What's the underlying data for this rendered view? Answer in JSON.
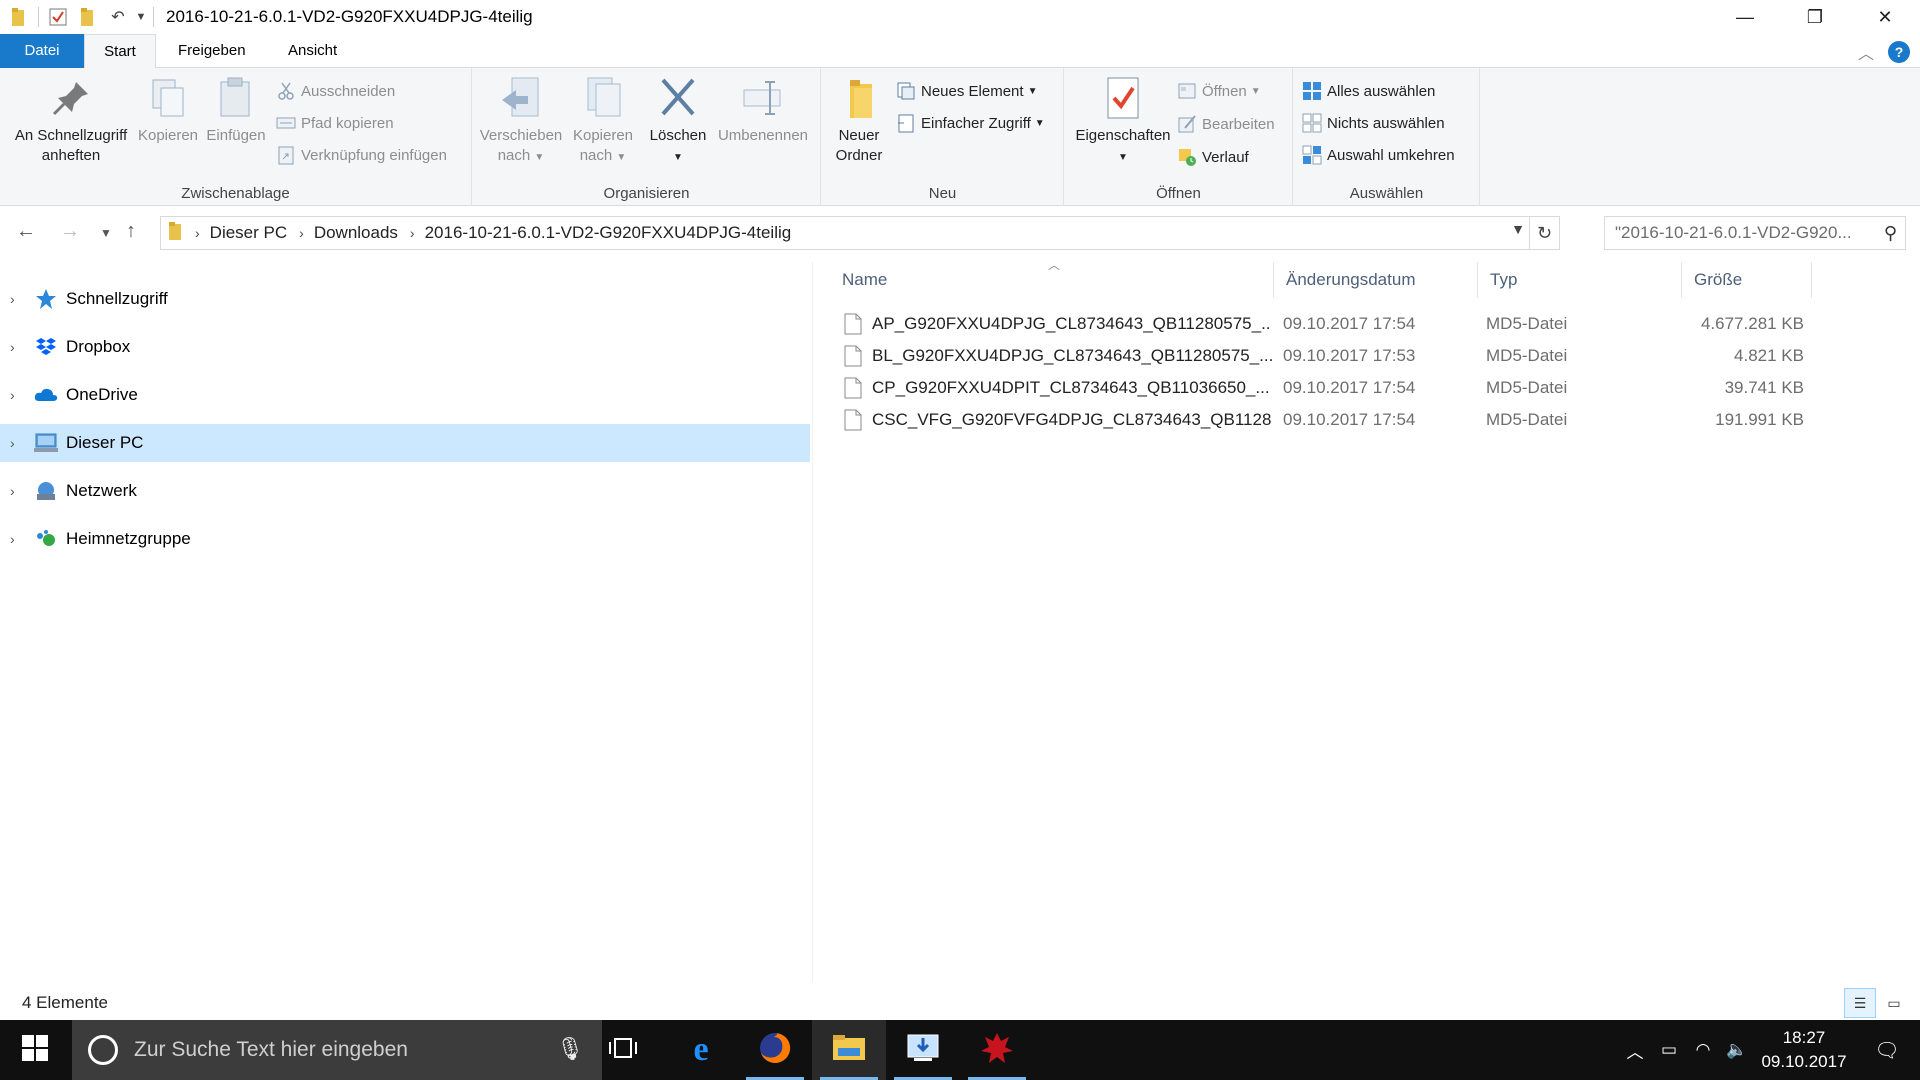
{
  "window": {
    "title": "2016-10-21-6.0.1-VD2-G920FXXU4DPJG-4teilig",
    "controls": {
      "minimize": "—",
      "restore": "❐",
      "close": "✕"
    }
  },
  "ribbon_tabs": {
    "file": "Datei",
    "start": "Start",
    "share": "Freigeben",
    "view": "Ansicht",
    "help": "?"
  },
  "ribbon": {
    "clipboard": {
      "label": "Zwischenablage",
      "pin_line1": "An Schnellzugriff",
      "pin_line2": "anheften",
      "copy": "Kopieren",
      "paste": "Einfügen",
      "cut": "Ausschneiden",
      "copy_path": "Pfad kopieren",
      "paste_shortcut": "Verknüpfung einfügen"
    },
    "organize": {
      "label": "Organisieren",
      "move_line1": "Verschieben",
      "move_line2": "nach",
      "copyto_line1": "Kopieren",
      "copyto_line2": "nach",
      "delete": "Löschen",
      "rename": "Umbenennen"
    },
    "new": {
      "label": "Neu",
      "folder_line1": "Neuer",
      "folder_line2": "Ordner",
      "new_item": "Neues Element",
      "easy_access": "Einfacher Zugriff"
    },
    "open": {
      "label": "Öffnen",
      "properties": "Eigenschaften",
      "open": "Öffnen",
      "edit": "Bearbeiten",
      "history": "Verlauf"
    },
    "select": {
      "label": "Auswählen",
      "select_all": "Alles auswählen",
      "select_none": "Nichts auswählen",
      "invert": "Auswahl umkehren"
    }
  },
  "address": {
    "crumbs": [
      "Dieser PC",
      "Downloads",
      "2016-10-21-6.0.1-VD2-G920FXXU4DPJG-4teilig"
    ],
    "search_placeholder": "\"2016-10-21-6.0.1-VD2-G920..."
  },
  "nav": [
    {
      "label": "Schnellzugriff",
      "icon": "star-icon",
      "selected": false
    },
    {
      "label": "Dropbox",
      "icon": "dropbox-icon",
      "selected": false
    },
    {
      "label": "OneDrive",
      "icon": "onedrive-cloud-icon",
      "selected": false
    },
    {
      "label": "Dieser PC",
      "icon": "computer-icon",
      "selected": true
    },
    {
      "label": "Netzwerk",
      "icon": "network-icon",
      "selected": false
    },
    {
      "label": "Heimnetzgruppe",
      "icon": "homegroup-icon",
      "selected": false
    }
  ],
  "columns": {
    "name": "Name",
    "date": "Änderungsdatum",
    "type": "Typ",
    "size": "Größe"
  },
  "files": [
    {
      "name": "AP_G920FXXU4DPJG_CL8734643_QB11280575_...",
      "date": "09.10.2017 17:54",
      "type": "MD5-Datei",
      "size": "4.677.281 KB"
    },
    {
      "name": "BL_G920FXXU4DPJG_CL8734643_QB11280575_...",
      "date": "09.10.2017 17:53",
      "type": "MD5-Datei",
      "size": "4.821 KB"
    },
    {
      "name": "CP_G920FXXU4DPIT_CL8734643_QB11036650_...",
      "date": "09.10.2017 17:54",
      "type": "MD5-Datei",
      "size": "39.741 KB"
    },
    {
      "name": "CSC_VFG_G920FVFG4DPJG_CL8734643_QB1128...",
      "date": "09.10.2017 17:54",
      "type": "MD5-Datei",
      "size": "191.991 KB"
    }
  ],
  "status": {
    "count": "4 Elemente"
  },
  "taskbar": {
    "search_placeholder": "Zur Suche Text hier eingeben",
    "time": "18:27",
    "date": "09.10.2017"
  },
  "colors": {
    "accent": "#1979ca",
    "selection": "#cce8ff",
    "taskbar": "#101010"
  }
}
